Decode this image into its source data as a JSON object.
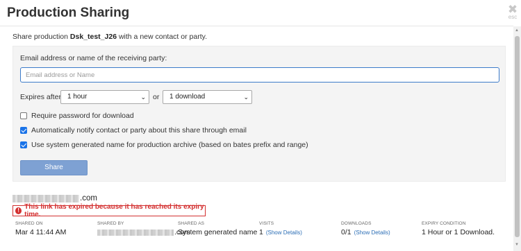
{
  "dialog": {
    "title": "Production Sharing",
    "close_label": "esc",
    "intro_prefix": "Share production",
    "production_name": "Dsk_test_J26",
    "intro_suffix": "with a new contact or party."
  },
  "form": {
    "email_label": "Email address or name of the receiving party:",
    "email_value": "",
    "email_placeholder": "Email address or Name",
    "expires_label": "Expires after",
    "expires_time": "1 hour",
    "or_label": "or",
    "expires_downloads": "1 download",
    "require_password": {
      "label": "Require password for download",
      "checked": false
    },
    "notify": {
      "label": "Automatically notify contact or party about this share through email",
      "checked": true
    },
    "system_name": {
      "label": "Use system generated name for production archive (based on bates prefix and range)",
      "checked": true
    },
    "share_button": "Share"
  },
  "shares": [
    {
      "recipient_suffix": ".com",
      "expired_message": "This link has expired because it has reached its expiry time.",
      "columns": {
        "shared_on": {
          "label": "SHARED ON",
          "value": "Mar 4 11:44 AM"
        },
        "shared_by": {
          "label": "SHARED BY",
          "value_suffix": ".com"
        },
        "shared_as": {
          "label": "SHARED AS",
          "value": "System generated name"
        },
        "visits": {
          "label": "VISITS",
          "value": "1",
          "link": "(Show Details)"
        },
        "downloads": {
          "label": "DOWNLOADS",
          "value": "0/1",
          "link": "(Show Details)"
        },
        "expiry": {
          "label": "EXPIRY CONDITION",
          "value": "1 Hour or 1 Download."
        }
      }
    }
  ],
  "colors": {
    "accent": "#3b7ac9",
    "share_button": "#7ea1d3",
    "error": "#d32f2f",
    "link": "#2a6db5"
  }
}
